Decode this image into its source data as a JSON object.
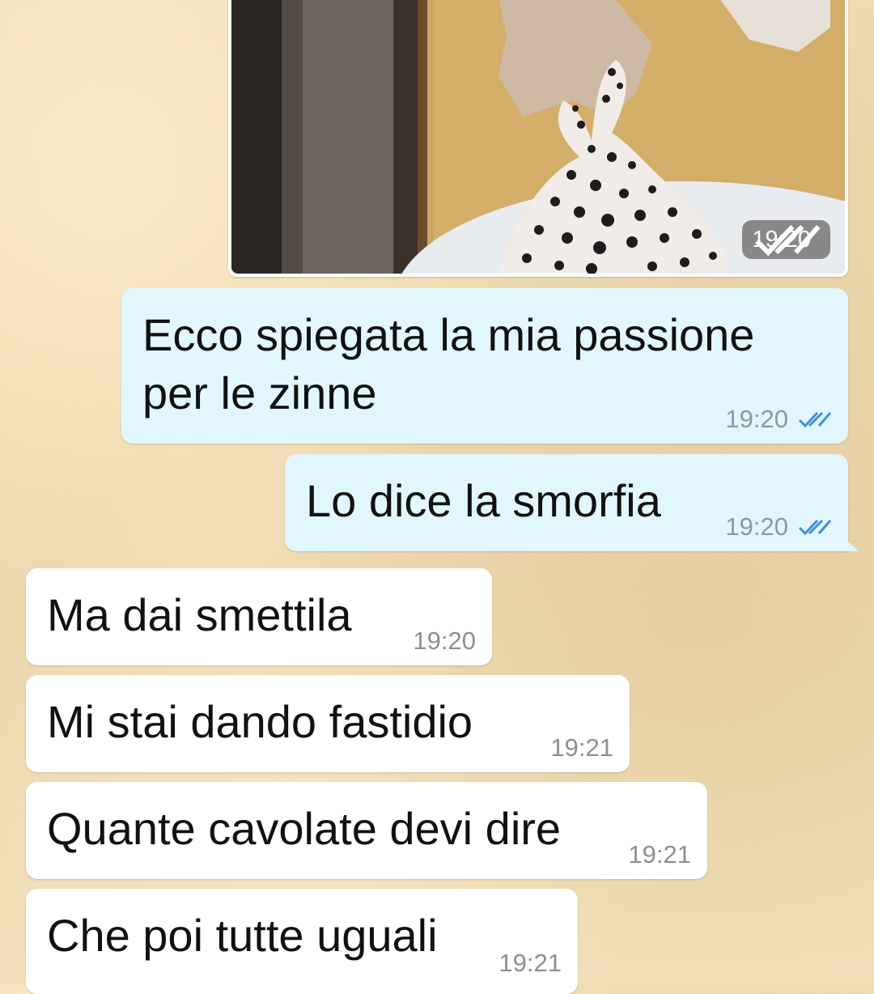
{
  "colors": {
    "outgoing_bubble": "#e1f7fd",
    "incoming_bubble": "#ffffff",
    "read_tick": "#3d8fd8",
    "wallpaper": "#efdcb4"
  },
  "image_message": {
    "time": "19:20",
    "status_icon": "double-check-icon"
  },
  "messages": [
    {
      "direction": "outgoing",
      "text": "Ecco spiegata la mia passione\nper le zinne",
      "time": "19:20",
      "status_icon": "double-check-read-icon"
    },
    {
      "direction": "outgoing",
      "text": "Lo dice la smorfia",
      "time": "19:20",
      "status_icon": "double-check-read-icon"
    },
    {
      "direction": "incoming",
      "text": "Ma dai smettila",
      "time": "19:20"
    },
    {
      "direction": "incoming",
      "text": "Mi stai dando fastidio",
      "time": "19:21"
    },
    {
      "direction": "incoming",
      "text": "Quante cavolate devi dire",
      "time": "19:21"
    },
    {
      "direction": "incoming",
      "text": "Che poi tutte uguali",
      "time": "19:21"
    }
  ]
}
